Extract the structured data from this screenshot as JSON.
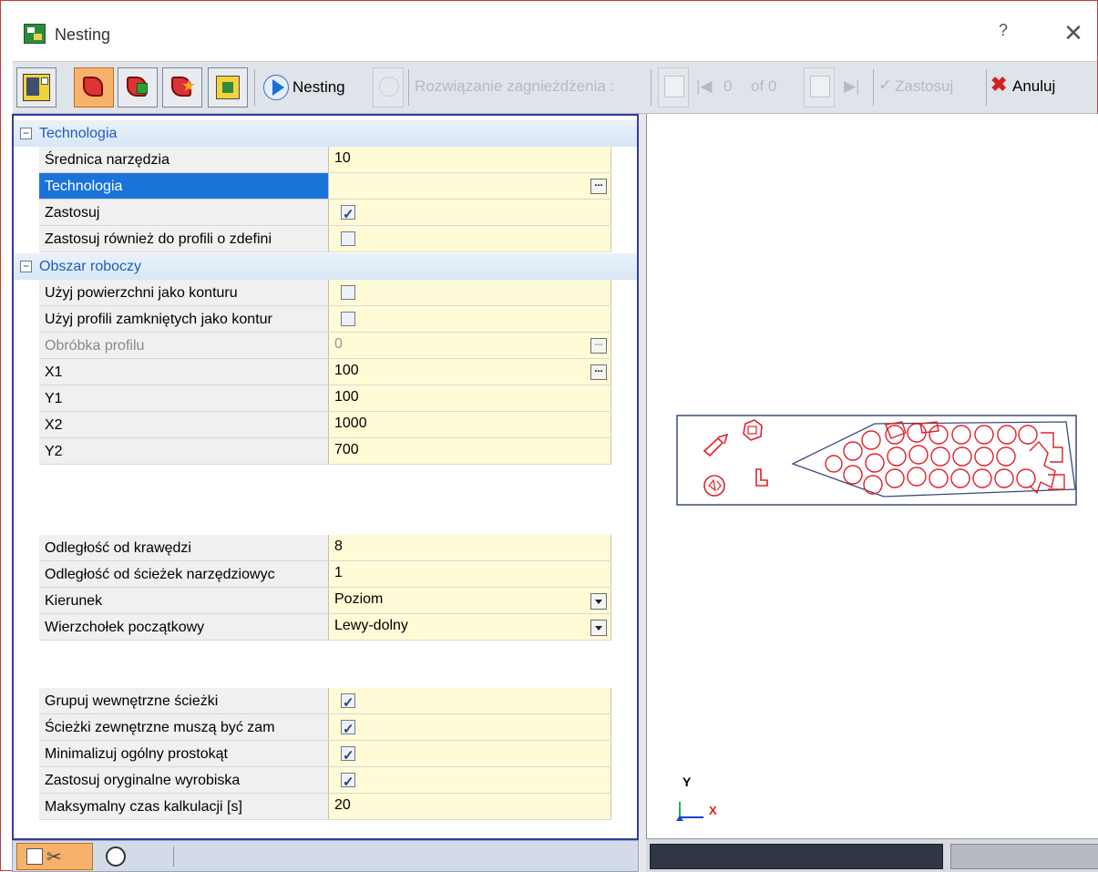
{
  "window": {
    "title": "Nesting",
    "help": "?",
    "close": "✕"
  },
  "toolbar": {
    "nesting_label": "Nesting",
    "solution_label": "Rozwiązanie zagnieżdżenia :",
    "counter_value": "0",
    "counter_of": "of 0",
    "apply_label": "Zastosuj",
    "cancel_label": "Anuluj",
    "colors": {
      "accent_red": "#d33333",
      "accent_blue": "#1d6fd8",
      "pressed": "#f6b26b"
    }
  },
  "sections": {
    "tech": "Technologia",
    "work": "Obszar roboczy"
  },
  "rows": {
    "srednica": {
      "label": "Średnica narzędzia",
      "value": "10"
    },
    "technologia": {
      "label": "Technologia",
      "value": ""
    },
    "zastosuj": {
      "label": "Zastosuj",
      "checked": true
    },
    "zastosuj_rowniez": {
      "label": "Zastosuj również do profili o zdefini",
      "checked": false
    },
    "uzyj_powierzchni": {
      "label": "Użyj powierzchni jako konturu",
      "checked": false
    },
    "uzyj_profili": {
      "label": "Użyj profili zamkniętych jako kontur",
      "checked": false
    },
    "obrobka": {
      "label": "Obróbka profilu",
      "value": "0"
    },
    "x1": {
      "label": "X1",
      "value": "100"
    },
    "y1": {
      "label": "Y1",
      "value": "100"
    },
    "x2": {
      "label": "X2",
      "value": "1000"
    },
    "y2": {
      "label": "Y2",
      "value": "700"
    },
    "odleglosc_krawedzi": {
      "label": "Odległość od krawędzi",
      "value": "8"
    },
    "odleglosc_sciezek": {
      "label": "Odległość od ścieżek narzędziowyc",
      "value": "1"
    },
    "kierunek": {
      "label": "Kierunek",
      "value": "Poziom"
    },
    "wierzcholek": {
      "label": "Wierzchołek początkowy",
      "value": "Lewy-dolny"
    },
    "grupuj": {
      "label": "Grupuj wewnętrzne ścieżki",
      "checked": true
    },
    "sciezki_zewn": {
      "label": "Ścieżki zewnętrzne muszą być zam",
      "checked": true
    },
    "minimalizuj": {
      "label": "Minimalizuj ogólny prostokąt",
      "checked": true
    },
    "zastosuj_oryg": {
      "label": "Zastosuj oryginalne wyrobiska",
      "checked": true
    },
    "max_czas": {
      "label": "Maksymalny czas kalkulacji [s]",
      "value": "20"
    }
  },
  "view": {
    "axis_y": "Y",
    "axis_x": "X",
    "part_color": "#e0202a",
    "sheet_color": "#3a4a7a"
  }
}
